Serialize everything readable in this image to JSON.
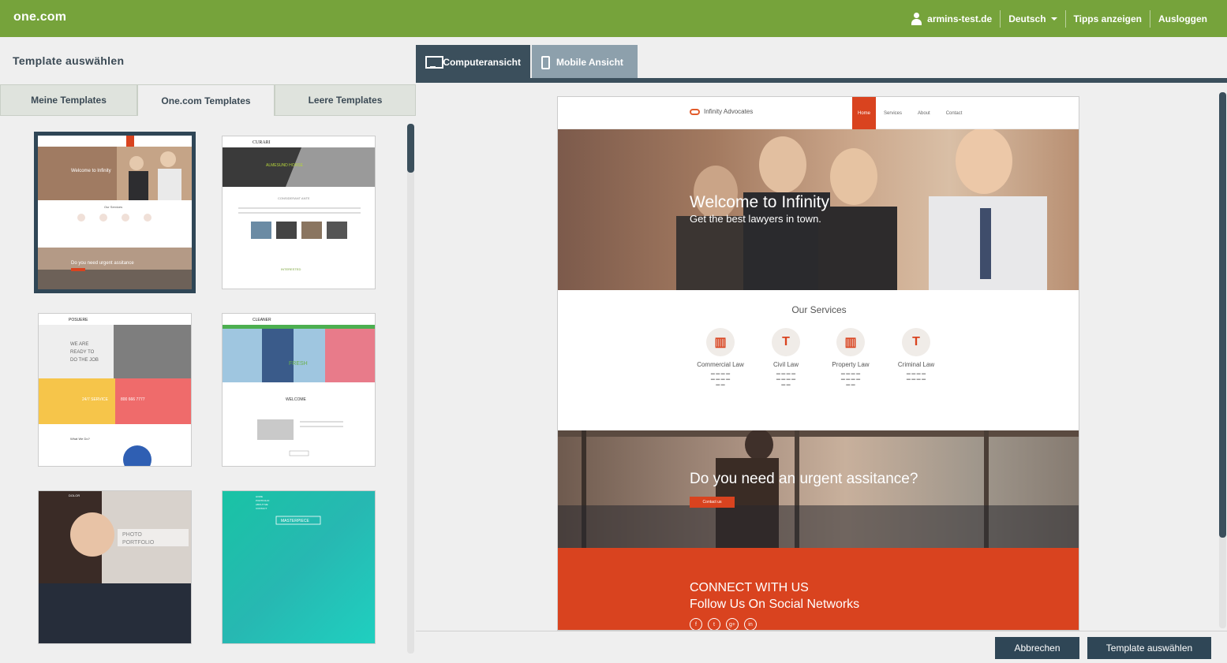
{
  "app": {
    "logo": "one.com",
    "user": "armins-test.de",
    "language": "Deutsch",
    "tips": "Tipps anzeigen",
    "logout": "Ausloggen"
  },
  "page": {
    "title": "Template auswählen"
  },
  "tabs": [
    {
      "label": "Meine Templates",
      "active": false
    },
    {
      "label": "One.com Templates",
      "active": true
    },
    {
      "label": "Leere Templates",
      "active": false
    }
  ],
  "templates": [
    {
      "name": "Infinity Advocates",
      "hero": "Welcome to Infinity",
      "selected": true
    },
    {
      "name": "Curari",
      "hero": "ALMESUND HORSE",
      "selected": false
    },
    {
      "name": "Posuere",
      "hero": "WE ARE READY TO DO THE JOB",
      "selected": false
    },
    {
      "name": "Cleaner",
      "hero": "FRESH",
      "selected": false
    },
    {
      "name": "Dolor",
      "hero": "PHOTO PORTFOLIO",
      "selected": false
    },
    {
      "name": "Masterpiece",
      "hero": "MASTERPIECE",
      "selected": false
    }
  ],
  "view": {
    "desktop_label": "Computeransicht",
    "mobile_label": "Mobile Ansicht",
    "active": "desktop"
  },
  "preview": {
    "brand": "Infinity Advocates",
    "menu": [
      "Home",
      "Services",
      "About",
      "Contact"
    ],
    "hero_title": "Welcome to Infinity",
    "hero_sub": "Get the best lawyers in town.",
    "services_title": "Our Services",
    "services": [
      {
        "label": "Commercial Law",
        "icon": "bank-icon"
      },
      {
        "label": "Civil Law",
        "icon": "gavel-icon"
      },
      {
        "label": "Property Law",
        "icon": "bank-icon"
      },
      {
        "label": "Criminal Law",
        "icon": "gavel-icon"
      }
    ],
    "urgent_title": "Do you need an urgent assitance?",
    "urgent_btn": "Contact us",
    "connect_title": "CONNECT WITH US",
    "connect_sub": "Follow Us On Social Networks",
    "social": [
      "f",
      "t",
      "g+",
      "in"
    ]
  },
  "footer": {
    "cancel": "Abbrechen",
    "choose": "Template auswählen"
  },
  "colors": {
    "brand_green": "#76a33b",
    "dark_slate": "#2f4656",
    "accent_orange": "#d9431f"
  }
}
